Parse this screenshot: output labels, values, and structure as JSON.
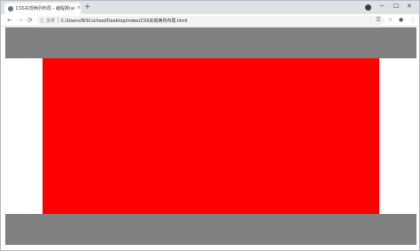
{
  "browser": {
    "tab": {
      "title": "CSS实现两列布局 - 编程狮(w3c",
      "close": "×"
    },
    "new_tab": "+",
    "window_controls": {
      "minimize": "─",
      "maximize": "☐",
      "close": "✕"
    },
    "nav": {
      "back": "←",
      "forward": "→",
      "reload": "⟳"
    },
    "address": {
      "info_icon": "ⓘ",
      "scheme_label": "文件",
      "url": "C:/Users/W3Cschool/Desktop/index/CSS实现两列布局.html"
    },
    "toolbar_icons": {
      "translate": "文",
      "star": "☆",
      "account": "●",
      "menu": "⋮"
    }
  },
  "page": {
    "colors": {
      "header": "#808080",
      "footer": "#808080",
      "main": "#ff0000",
      "side": "#ffffff"
    }
  }
}
